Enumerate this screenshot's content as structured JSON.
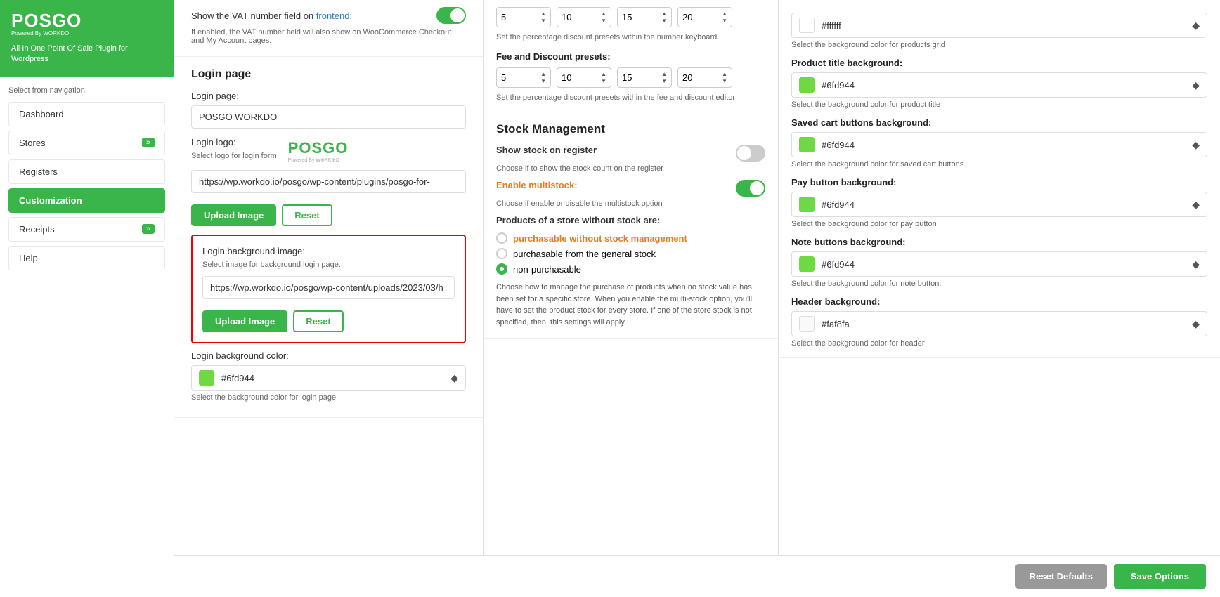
{
  "sidebar": {
    "logo": "POSGO",
    "powered_by": "Powered By WORKDO",
    "tagline": "All In One Point Of Sale Plugin for Wordpress",
    "nav_label": "Select from navigation:",
    "items": [
      {
        "id": "dashboard",
        "label": "Dashboard",
        "active": false,
        "has_arrow": false
      },
      {
        "id": "stores",
        "label": "Stores",
        "active": false,
        "has_arrow": true
      },
      {
        "id": "registers",
        "label": "Registers",
        "active": false,
        "has_arrow": false
      },
      {
        "id": "customization",
        "label": "Customization",
        "active": true,
        "has_arrow": false
      },
      {
        "id": "receipts",
        "label": "Receipts",
        "active": false,
        "has_arrow": true
      },
      {
        "id": "help",
        "label": "Help",
        "active": false,
        "has_arrow": false
      }
    ]
  },
  "vat_section": {
    "text": "Show the VAT number field on frontend;",
    "subtext": "If enabled, the VAT number field will also show on WooCommerce Checkout and My Account pages.",
    "toggle_on": true
  },
  "login_page": {
    "section_title": "Login page",
    "login_page_label": "Login page:",
    "login_page_value": "POSGO WORKDO",
    "login_logo_label": "Login logo:",
    "select_logo_label": "Select logo for login form",
    "logo_url": "https://wp.workdo.io/posgo/wp-content/plugins/posgo-for-",
    "upload_btn_label": "Upload Image",
    "reset_btn_label": "Reset",
    "bg_image_label": "Login background image:",
    "bg_image_sublabel": "Select image for background login page.",
    "bg_image_url": "https://wp.workdo.io/posgo/wp-content/uploads/2023/03/h",
    "upload_btn2_label": "Upload Image",
    "reset_btn2_label": "Reset",
    "bg_color_label": "Login background color:",
    "bg_color_value": "#6fd944",
    "bg_color_sublabel": "Select the background color for login page"
  },
  "discount_presets": {
    "presets_label": "Set the percentage discount presets within the number keyboard",
    "values1": [
      5,
      10,
      15,
      20
    ],
    "fee_label": "Fee and Discount presets:",
    "fee_sublabel": "Set the percentage discount presets within the fee and discount editor",
    "values2": [
      5,
      10,
      15,
      20
    ]
  },
  "stock_management": {
    "title": "Stock Management",
    "show_stock_label": "Show stock on register",
    "show_stock_sub": "Choose if to show the stock count on the register",
    "show_stock_toggle": false,
    "enable_multistock_label": "Enable multistock:",
    "enable_multistock_sub": "Choose if enable or disable the multistock option",
    "enable_multistock_toggle": true,
    "products_label": "Products of a store without stock are:",
    "radio_options": [
      {
        "id": "purchasable_no_mgmt",
        "label": "purchasable without stock management",
        "selected": false
      },
      {
        "id": "purchasable_general",
        "label": "purchasable from the general stock",
        "selected": false
      },
      {
        "id": "non_purchasable",
        "label": "non-purchasable",
        "selected": true
      }
    ],
    "description": "Choose how to manage the purchase of products when no stock value has been set for a specific store. When you enable the multi-stock option, you'll have to set the product stock for every store. If one of the store stock is not specified, then, this settings will apply."
  },
  "color_settings": {
    "bg_grid_sublabel": "Select the background color for products grid",
    "bg_grid_value": "#ffffff",
    "product_title_bg_label": "Product title background:",
    "product_title_bg_value": "#6fd944",
    "product_title_bg_sub": "Select the background color for product title",
    "saved_cart_bg_label": "Saved cart buttons background:",
    "saved_cart_bg_value": "#6fd944",
    "saved_cart_bg_sub": "Select the background color for saved cart buttons",
    "pay_btn_bg_label": "Pay button background:",
    "pay_btn_bg_value": "#6fd944",
    "pay_btn_bg_sub": "Select the background color for pay button",
    "note_btn_bg_label": "Note buttons background:",
    "note_btn_bg_value": "#6fd944",
    "note_btn_bg_sub": "Select the background color for note button:",
    "header_bg_label": "Header background:",
    "header_bg_value": "#faf8fa",
    "header_bg_sub": "Select the background color for header"
  },
  "bottom_bar": {
    "reset_label": "Reset Defaults",
    "save_label": "Save Options"
  }
}
